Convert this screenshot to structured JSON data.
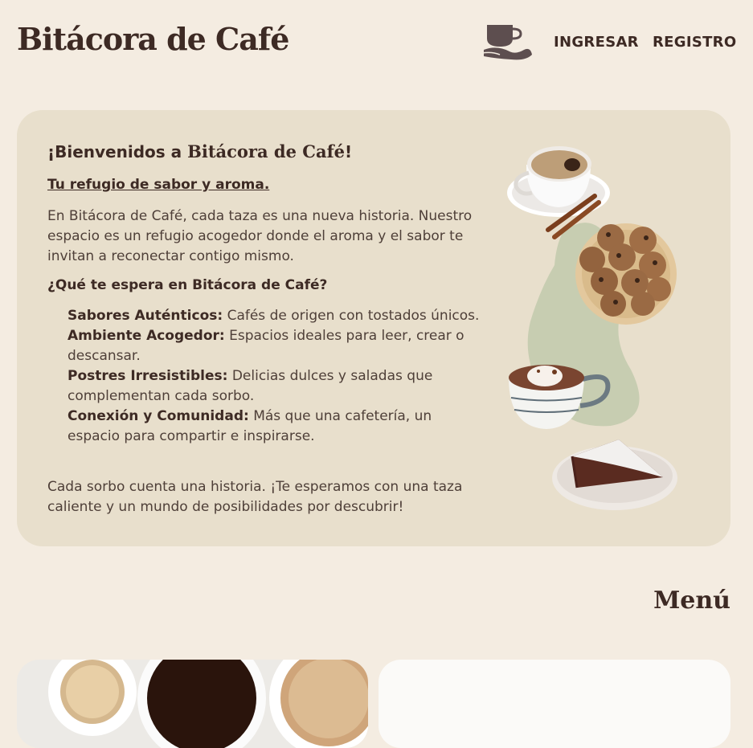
{
  "header": {
    "brand": "Bitácora de Café",
    "nav": {
      "login": "INGRESAR",
      "register": "REGISTRO"
    }
  },
  "welcome": {
    "title_prefix": "¡Bienvenidos a ",
    "title_brand": "Bitácora de Café",
    "title_suffix": "!",
    "tagline": "Tu refugio de sabor y aroma.",
    "intro": "En Bitácora de Café, cada taza es una nueva historia. Nuestro espacio es un refugio acogedor donde el aroma y el sabor te invitan a reconectar contigo mismo.",
    "features_heading": "¿Qué te espera en Bitácora de Café?",
    "features": [
      {
        "name": "Sabores Auténticos:",
        "desc": " Cafés de origen con tostados únicos."
      },
      {
        "name": "Ambiente Acogedor:",
        "desc": " Espacios ideales para leer, crear o descansar."
      },
      {
        "name": "Postres Irresistibles:",
        "desc": " Delicias dulces y saladas que complementan cada sorbo."
      },
      {
        "name": "Conexión y Comunidad:",
        "desc": " Más que una cafetería, un espacio para compartir e inspirarse."
      }
    ],
    "closing": "Cada sorbo cuenta una historia. ¡Te esperamos con una taza caliente y un mundo de posibilidades por descubrir!"
  },
  "menu": {
    "heading": "Menú"
  },
  "icons": {
    "logo": "cup-in-hand-icon",
    "art": [
      "coffee-cup-icon",
      "cinnamon-sticks-icon",
      "cookies-plate-icon",
      "hot-chocolate-icon",
      "cake-slice-icon"
    ]
  },
  "colors": {
    "background": "#f4ece1",
    "card": "#e8dfcc",
    "text": "#3d2a24",
    "blob": "#c7cdb1"
  }
}
